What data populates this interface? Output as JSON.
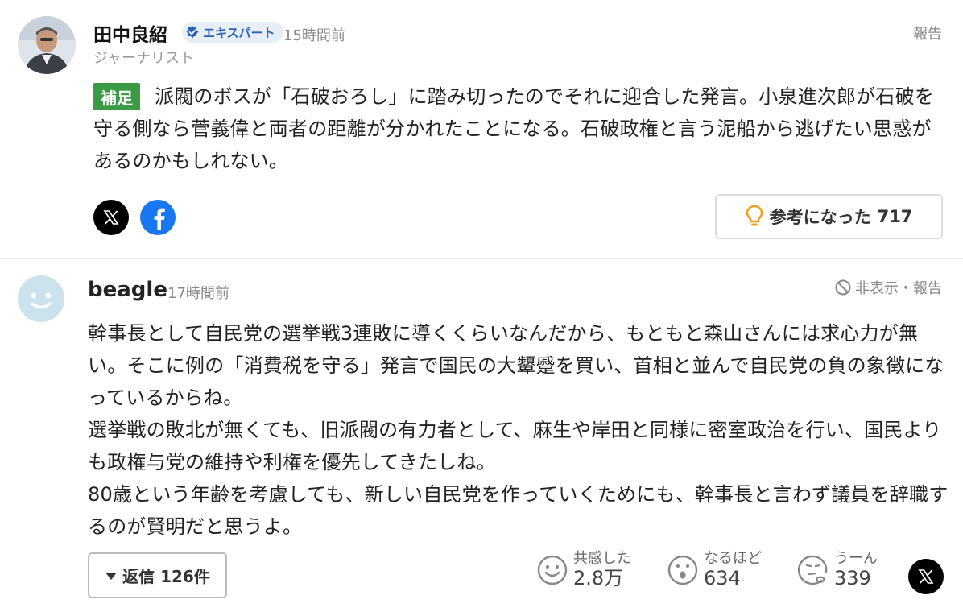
{
  "expert_comment": {
    "author_name": "田中良紹",
    "badge_label": "エキスパート",
    "time": "15時間前",
    "report_label": "報告",
    "role": "ジャーナリスト",
    "tag": "補足",
    "body": "派閥のボスが「石破おろし」に踏み切ったのでそれに迎合した発言。小泉進次郎が石破を守る側なら菅義偉と両者の距離が分かれたことになる。石破政権と言う泥船から逃げたい思惑があるのかもしれない。",
    "helpful_label": "参考になった",
    "helpful_count": "717"
  },
  "user_comment": {
    "username": "beagle",
    "time": "17時間前",
    "hide_report_label": "非表示・報告",
    "paragraphs": [
      "幹事長として自民党の選挙戦3連敗に導くくらいなんだから、もともと森山さんには求心力が無い。そこに例の「消費税を守る」発言で国民の大顰蹙を買い、首相と並んで自民党の負の象徴になっているからね。",
      "選挙戦の敗北が無くても、旧派閥の有力者として、麻生や岸田と同様に密室政治を行い、国民よりも政権与党の維持や利権を優先してきたしね。",
      "80歳という年齢を考慮しても、新しい自民党を作っていくためにも、幹事長と言わず議員を辞職するのが賢明だと思うよ。"
    ],
    "reply_label": "返信 126件",
    "reactions": [
      {
        "label": "共感した",
        "count": "2.8万",
        "icon": "smile-face-icon"
      },
      {
        "label": "なるほど",
        "count": "634",
        "icon": "surprised-face-icon"
      },
      {
        "label": "うーん",
        "count": "339",
        "icon": "thinking-face-icon"
      }
    ]
  },
  "colors": {
    "tag_green": "#3b9a44",
    "badge_blue": "#2a63b8",
    "facebook_blue": "#1877f2",
    "bulb_orange": "#f0a020"
  }
}
